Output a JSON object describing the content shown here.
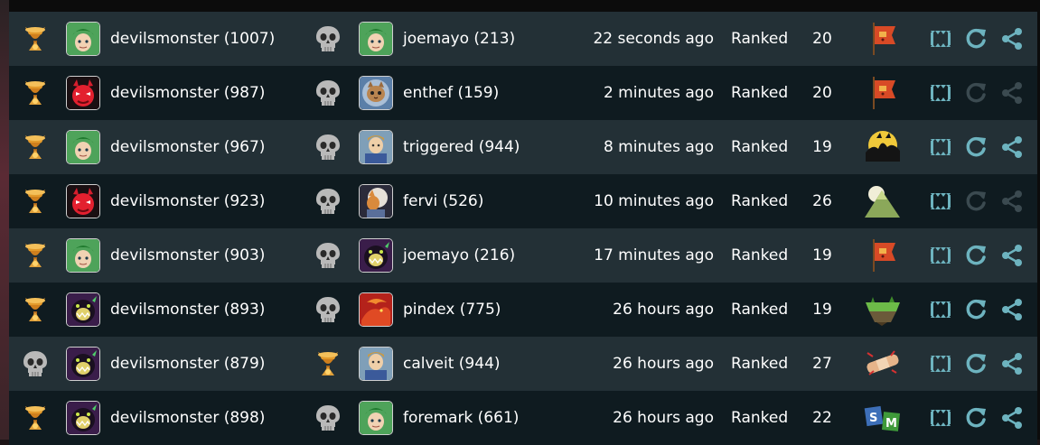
{
  "colors": {
    "row_odd": "#233036",
    "row_even": "#0f1b20",
    "action_active": "#6db3bf",
    "action_disabled": "#3b4a50",
    "trophy": "#e39a2b",
    "skull": "#b9b9b9"
  },
  "games": [
    {
      "p1_result": "trophy-icon",
      "p1_avatar": "green-hair-avatar",
      "p1_name": "devilsmonster (1007)",
      "p2_result": "skull-icon",
      "p2_avatar": "green-hair-avatar",
      "p2_name": "joemayo (213)",
      "time": "22 seconds ago",
      "mode": "Ranked",
      "turns": "20",
      "map": "banner-flag-map-icon",
      "replay_enabled": true,
      "share_enabled": true
    },
    {
      "p1_result": "trophy-icon",
      "p1_avatar": "red-devil-avatar",
      "p1_name": "devilsmonster (987)",
      "p2_result": "skull-icon",
      "p2_avatar": "cat-astronaut-avatar",
      "p2_name": "enthef (159)",
      "time": "2 minutes ago",
      "mode": "Ranked",
      "turns": "20",
      "map": "banner-flag-map-icon",
      "replay_enabled": false,
      "share_enabled": false
    },
    {
      "p1_result": "trophy-icon",
      "p1_avatar": "green-hair-avatar",
      "p1_name": "devilsmonster (967)",
      "p2_result": "skull-icon",
      "p2_avatar": "knight-avatar",
      "p2_name": "triggered (944)",
      "time": "8 minutes ago",
      "mode": "Ranked",
      "turns": "19",
      "map": "night-silhouette-map-icon",
      "replay_enabled": true,
      "share_enabled": true
    },
    {
      "p1_result": "trophy-icon",
      "p1_avatar": "red-devil-avatar",
      "p1_name": "devilsmonster (923)",
      "p2_result": "skull-icon",
      "p2_avatar": "fox-space-avatar",
      "p2_name": "fervi (526)",
      "time": "10 minutes ago",
      "mode": "Ranked",
      "turns": "26",
      "map": "mountain-moon-map-icon",
      "replay_enabled": false,
      "share_enabled": false
    },
    {
      "p1_result": "trophy-icon",
      "p1_avatar": "green-hair-avatar",
      "p1_name": "devilsmonster (903)",
      "p2_result": "skull-icon",
      "p2_avatar": "dark-monster-avatar",
      "p2_name": "joemayo (216)",
      "time": "17 minutes ago",
      "mode": "Ranked",
      "turns": "19",
      "map": "banner-flag-map-icon",
      "replay_enabled": true,
      "share_enabled": true
    },
    {
      "p1_result": "trophy-icon",
      "p1_avatar": "dark-monster-avatar",
      "p1_name": "devilsmonster (893)",
      "p2_result": "skull-icon",
      "p2_avatar": "red-dragon-avatar",
      "p2_name": "pindex (775)",
      "time": "26 hours ago",
      "mode": "Ranked",
      "turns": "19",
      "map": "floating-island-map-icon",
      "replay_enabled": true,
      "share_enabled": true
    },
    {
      "p1_result": "skull-icon",
      "p1_avatar": "dark-monster-avatar",
      "p1_name": "devilsmonster (879)",
      "p2_result": "trophy-icon",
      "p2_avatar": "knight-avatar",
      "p2_name": "calveit (944)",
      "time": "26 hours ago",
      "mode": "Ranked",
      "turns": "27",
      "map": "bandage-map-icon",
      "replay_enabled": true,
      "share_enabled": true
    },
    {
      "p1_result": "trophy-icon",
      "p1_avatar": "dark-monster-avatar",
      "p1_name": "devilsmonster (898)",
      "p2_result": "skull-icon",
      "p2_avatar": "green-hair-avatar",
      "p2_name": "foremark (661)",
      "time": "26 hours ago",
      "mode": "Ranked",
      "turns": "22",
      "map": "sm-blocks-map-icon",
      "replay_enabled": true,
      "share_enabled": true
    }
  ]
}
